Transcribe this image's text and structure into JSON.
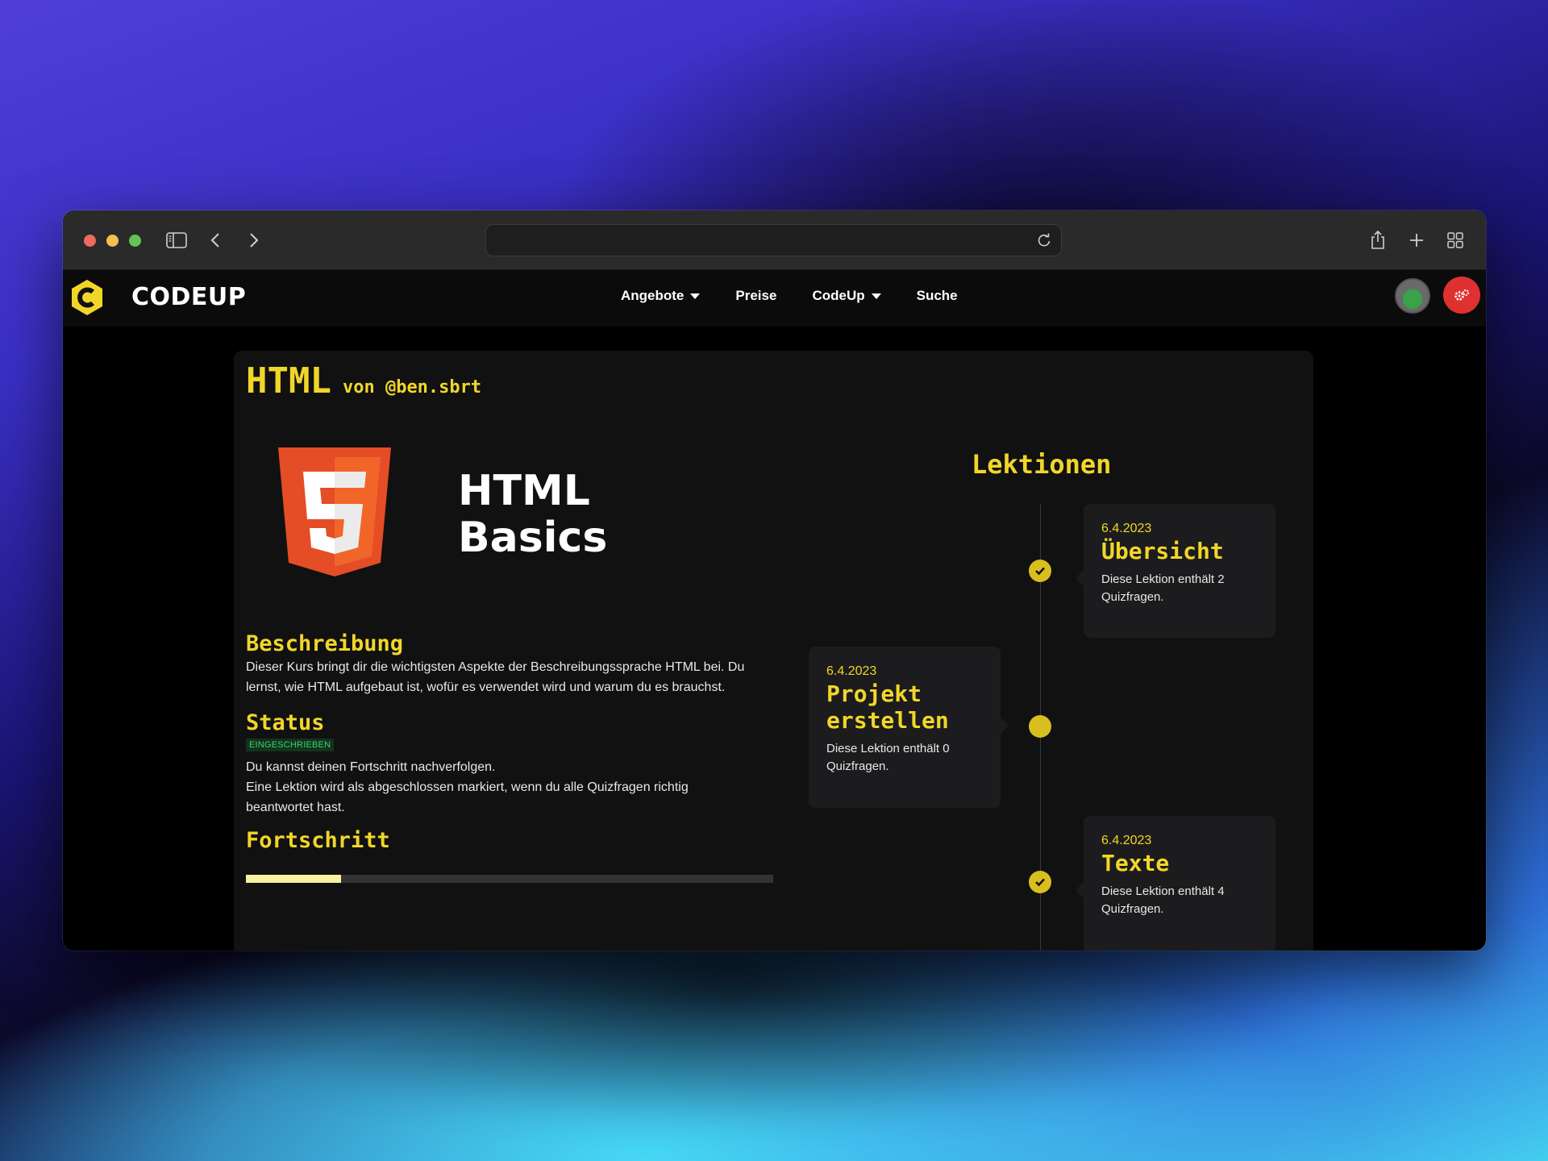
{
  "browser": {
    "url": ""
  },
  "navbar": {
    "brand": "CODEUP",
    "links": [
      {
        "label": "Angebote",
        "dropdown": true
      },
      {
        "label": "Preise",
        "dropdown": false
      },
      {
        "label": "CodeUp",
        "dropdown": true
      },
      {
        "label": "Suche",
        "dropdown": false
      }
    ]
  },
  "course": {
    "title": "HTML",
    "author": "von @ben.sbrt",
    "hero_line1": "HTML",
    "hero_line2": "Basics",
    "description_heading": "Beschreibung",
    "description": "Dieser Kurs bringt dir die wichtigsten Aspekte der Beschreibungssprache HTML bei. Du lernst, wie HTML aufgebaut ist, wofür es verwendet wird und warum du es brauchst.",
    "status_heading": "Status",
    "status_badge": "EINGESCHRIEBEN",
    "status_text_1": "Du kannst deinen Fortschritt nachverfolgen.",
    "status_text_2": "Eine Lektion wird als abgeschlossen markiert, wenn du alle Quizfragen richtig beantwortet hast.",
    "progress_heading": "Fortschritt",
    "progress_fraction": 0.18
  },
  "lessons": {
    "heading": "Lektionen",
    "items": [
      {
        "date": "6.4.2023",
        "title": "Übersicht",
        "desc": "Diese Lektion enthält 2 Quizfragen.",
        "completed": true
      },
      {
        "date": "6.4.2023",
        "title": "Projekt erstellen",
        "desc": "Diese Lektion enthält 0 Quizfragen.",
        "completed": false
      },
      {
        "date": "6.4.2023",
        "title": "Texte",
        "desc": "Diese Lektion enthält 4 Quizfragen.",
        "completed": true
      }
    ]
  },
  "colors": {
    "accent": "#f1d629",
    "badge_bg": "#12331c",
    "badge_text": "#3bd16f",
    "settings_red": "#e03131"
  }
}
